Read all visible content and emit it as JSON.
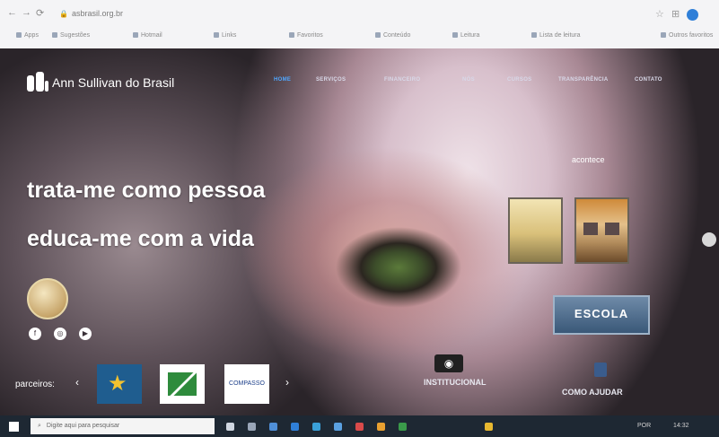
{
  "browser": {
    "url": "asbrasil.org.br",
    "bookmarks": [
      "Apps",
      "Sugestões",
      "Hotmail",
      "Links",
      "Favoritos",
      "Conteúdo",
      "Leitura",
      "Lista de leitura",
      "Outros favoritos"
    ]
  },
  "site": {
    "brand": "Ann Sullivan do Brasil",
    "nav": [
      "HOME",
      "SERVIÇOS",
      "FINANCEIRO",
      "NÓS",
      "CURSOS",
      "TRANSPARÊNCIA",
      "CONTATO"
    ],
    "active_nav": "HOME",
    "headline": [
      "trata-me como pessoa",
      "educa-me com a vida"
    ],
    "acontece_label": "acontece",
    "social_icons": [
      "facebook-icon",
      "instagram-icon",
      "youtube-icon"
    ],
    "escola_label": "ESCOLA",
    "parceiros_label": "parceiros:",
    "partner_logos": [
      "partner-star-logo",
      "partner-leaf-logo",
      "COMPASSO"
    ],
    "institucional_label": "INSTITUCIONAL",
    "como_ajudar_label": "COMO AJUDAR"
  },
  "taskbar": {
    "search_placeholder": "Digite aqui para pesquisar",
    "tray_time": "14:32",
    "tray_lang": "POR"
  },
  "colors": {
    "active_nav": "#4fa7ff",
    "taskbar": "#1e2833",
    "profile": "#2f7fd8"
  }
}
